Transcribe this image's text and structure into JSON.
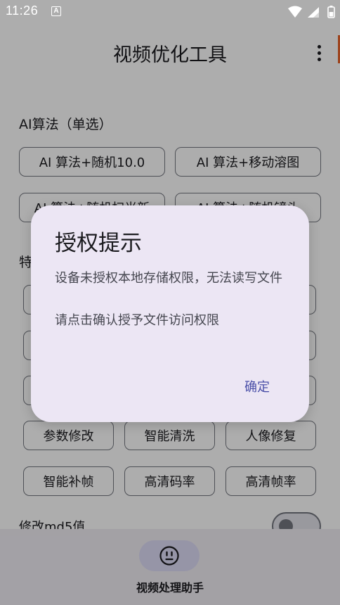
{
  "status_bar": {
    "time": "11:26",
    "notification_icon_letter": "A",
    "icons": [
      "wifi-icon",
      "signal-icon",
      "battery-icon"
    ]
  },
  "app_bar": {
    "title": "视频优化工具",
    "menu_icon": "more-vert-icon"
  },
  "algorithms": {
    "label": "AI算法（单选）",
    "options": [
      "AI 算法+随机10.0",
      "AI 算法+移动溶图",
      "AI 算法+随机扫光新",
      "AI 算法+随机镜头"
    ]
  },
  "features": {
    "label": "特",
    "chips": [
      "参数修改",
      "智能清洗",
      "人像修复",
      "智能补帧",
      "高清码率",
      "高清帧率"
    ]
  },
  "md5_switch": {
    "label": "修改md5值",
    "checked": false
  },
  "bottom_nav": {
    "icon": "smiley-face-icon",
    "label": "视频处理助手"
  },
  "dialog": {
    "title": "授权提示",
    "message_1": "设备未授权本地存储权限，无法读写文件",
    "message_2": "请点击确认授予文件访问权限",
    "confirm_label": "确定"
  },
  "colors": {
    "accent": "#4a4fa8",
    "dialog_background": "#ece6f4",
    "outline": "#74777f",
    "nav_indicator": "#dedcf6"
  }
}
